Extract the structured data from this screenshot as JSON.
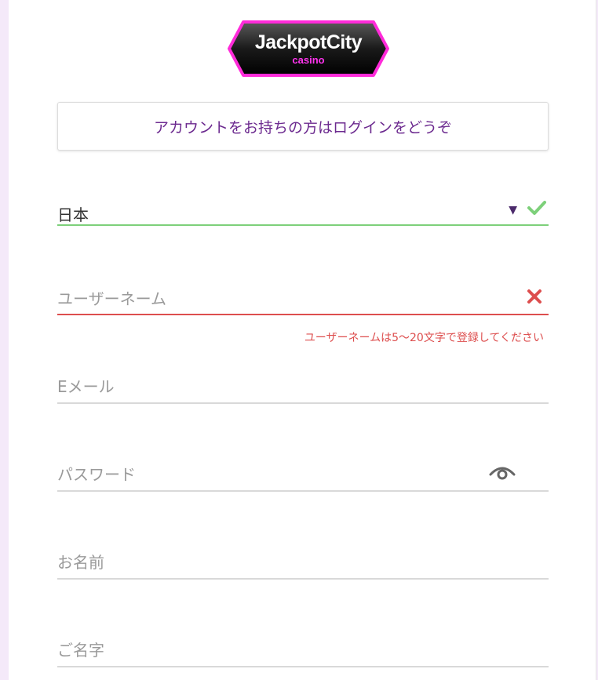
{
  "logo": {
    "main": "JackpotCity",
    "sub": "casino"
  },
  "login_prompt": "アカウントをお持ちの方はログインをどうぞ",
  "form": {
    "country": {
      "value": "日本",
      "status": "valid",
      "status_color": "#7dd07a"
    },
    "username": {
      "placeholder": "ユーザーネーム",
      "status": "invalid",
      "error": "ユーザーネームは5～20文字で登録してください",
      "error_color": "#dd4e4e"
    },
    "email": {
      "placeholder": "Eメール"
    },
    "password": {
      "placeholder": "パスワード",
      "icon": "eye-icon"
    },
    "first_name": {
      "placeholder": "お名前"
    },
    "last_name": {
      "placeholder": "ご名字"
    }
  },
  "colors": {
    "accent": "#6c2a8f",
    "background": "#f4e9f9"
  }
}
